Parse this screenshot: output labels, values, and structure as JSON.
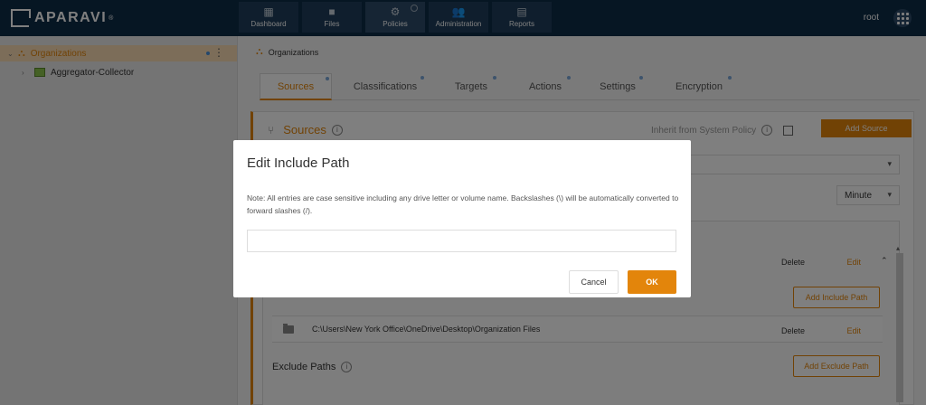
{
  "app": {
    "brand": "APARAVI",
    "reg_mark": "®"
  },
  "nav": {
    "tabs": [
      {
        "label": "Dashboard",
        "icon": "dashboard-icon"
      },
      {
        "label": "Files",
        "icon": "folder-icon"
      },
      {
        "label": "Policies",
        "icon": "gear-icon",
        "active": true
      },
      {
        "label": "Administration",
        "icon": "users-icon"
      },
      {
        "label": "Reports",
        "icon": "clipboard-icon"
      }
    ],
    "user": "root"
  },
  "tree": {
    "root_label": "Organizations",
    "child_label": "Aggregator-Collector"
  },
  "breadcrumb": {
    "label": "Organizations"
  },
  "subtabs": [
    "Sources",
    "Classifications",
    "Targets",
    "Actions",
    "Settings",
    "Encryption"
  ],
  "sources": {
    "title": "Sources",
    "inherit_label": "Inherit from System Policy",
    "add_source_label": "Add Source",
    "interval_value": "Minute",
    "delete_label": "Delete",
    "edit_label": "Edit",
    "add_include_label": "Add Include Path",
    "add_exclude_label": "Add Exclude Path",
    "include_path": "C:\\Users\\New York Office\\OneDrive\\Desktop\\Organization Files",
    "exclude_label": "Exclude Paths"
  },
  "modal": {
    "title": "Edit Include Path",
    "note": "Note: All entries are case sensitive including any drive letter or volume name. Backslashes (\\) will be automatically converted to forward slashes (/).",
    "input_value": "",
    "cancel_label": "Cancel",
    "ok_label": "OK"
  },
  "colors": {
    "accent": "#e3850b",
    "nav_bg": "#0d2c47",
    "selected_bg": "#f8dab2"
  }
}
